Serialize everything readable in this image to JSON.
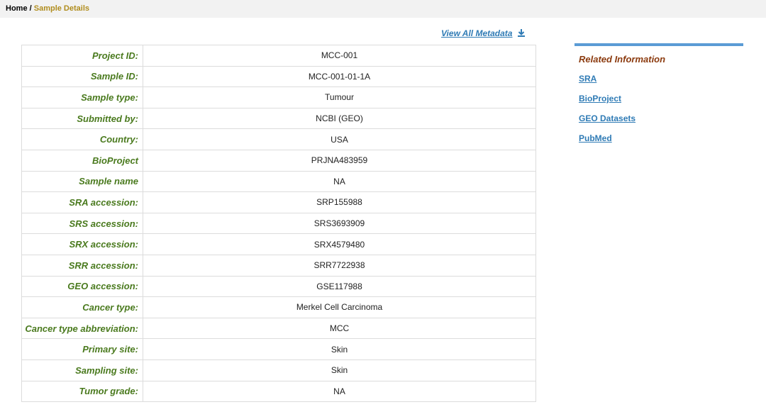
{
  "breadcrumb": {
    "home": "Home",
    "separator": " / ",
    "current": "Sample Details"
  },
  "view_all": {
    "label": "View All Metadata",
    "icon": "download-icon"
  },
  "metadata_rows": [
    {
      "key": "Project ID:",
      "value": "MCC-001"
    },
    {
      "key": "Sample ID:",
      "value": "MCC-001-01-1A"
    },
    {
      "key": "Sample type:",
      "value": "Tumour"
    },
    {
      "key": "Submitted by:",
      "value": "NCBI (GEO)"
    },
    {
      "key": "Country:",
      "value": "USA"
    },
    {
      "key": "BioProject",
      "value": "PRJNA483959"
    },
    {
      "key": "Sample name",
      "value": "NA"
    },
    {
      "key": "SRA accession:",
      "value": "SRP155988"
    },
    {
      "key": "SRS accession:",
      "value": "SRS3693909"
    },
    {
      "key": "SRX accession:",
      "value": "SRX4579480"
    },
    {
      "key": "SRR accession:",
      "value": "SRR7722938"
    },
    {
      "key": "GEO accession:",
      "value": "GSE117988"
    },
    {
      "key": "Cancer type:",
      "value": "Merkel Cell Carcinoma"
    },
    {
      "key": "Cancer type abbreviation:",
      "value": "MCC"
    },
    {
      "key": "Primary site:",
      "value": "Skin"
    },
    {
      "key": "Sampling site:",
      "value": "Skin"
    },
    {
      "key": "Tumor grade:",
      "value": "NA"
    }
  ],
  "related": {
    "title": "Related Information",
    "links": [
      "SRA",
      "BioProject",
      "GEO Datasets",
      "PubMed"
    ]
  },
  "colors": {
    "key_text": "#4a7a1e",
    "link": "#2f7bb5",
    "related_title": "#8b3a0e",
    "accent_bar": "#5b9bd5",
    "breadcrumb_current": "#b08d1e"
  }
}
